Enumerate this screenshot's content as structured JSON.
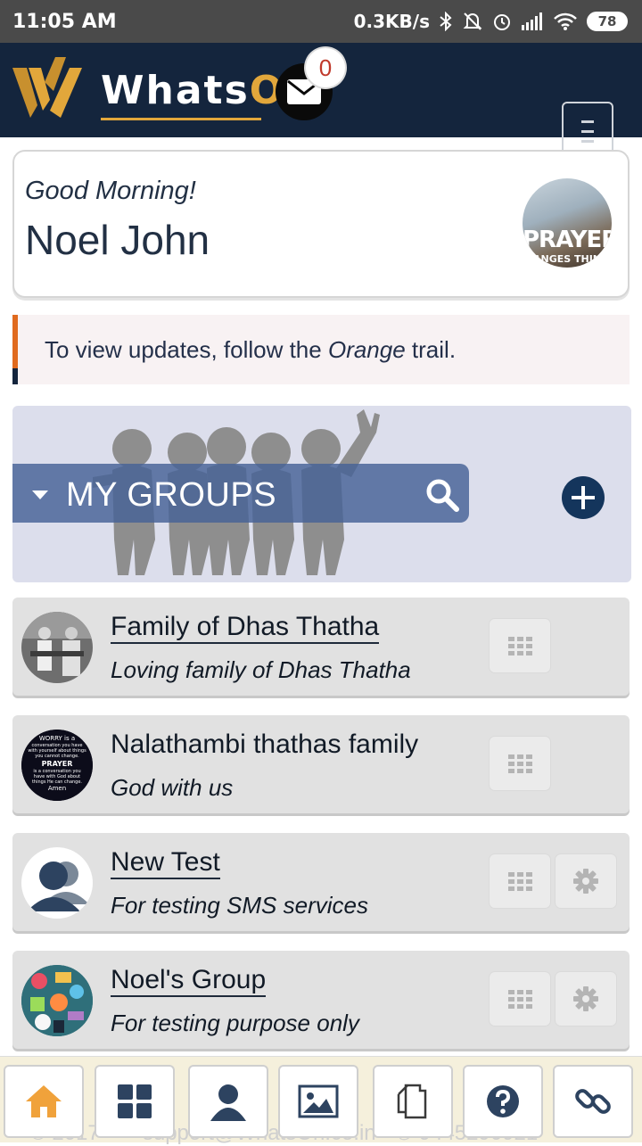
{
  "status_bar": {
    "time": "11:05 AM",
    "speed": "0.3KB/s",
    "battery": "78"
  },
  "header": {
    "brand_main": "Whats",
    "brand_accent": "On",
    "mail_count": "0",
    "brand_color": "#e2a73b",
    "bg_color": "#14253d"
  },
  "greeting": {
    "salutation": "Good Morning!",
    "user_name": "Noel John",
    "avatar_line1": "PRAYER",
    "avatar_line2": "ANGES THIN"
  },
  "info": {
    "text_before": "To view updates, follow the ",
    "text_emph": "Orange",
    "text_after": " trail."
  },
  "groups_section": {
    "label": "MY GROUPS"
  },
  "groups": [
    {
      "title": "Family of Dhas Thatha",
      "description": "Loving family of Dhas Thatha",
      "has_settings": false
    },
    {
      "title": "Nalathambi thathas family",
      "description": "God with us",
      "has_settings": false,
      "avatar_text": [
        "WORRY is a",
        "conversation you have",
        "with yourself about things",
        "you cannot change.",
        "PRAYER",
        "is a conversation you",
        "have with God about",
        "things He can change.",
        "Amen"
      ]
    },
    {
      "title": "New Test",
      "description": "For testing SMS services",
      "has_settings": true
    },
    {
      "title": "Noel's Group",
      "description": "For testing purpose only",
      "has_settings": true
    }
  ],
  "footer": {
    "ghost_text": "© 2017 · ✉ support@WhatsOn.co.in · ✆ 9445290921"
  },
  "bottom_nav": [
    "home-icon",
    "dashboard-icon",
    "profile-icon",
    "gallery-icon",
    "copy-icon",
    "help-icon",
    "link-icon"
  ]
}
